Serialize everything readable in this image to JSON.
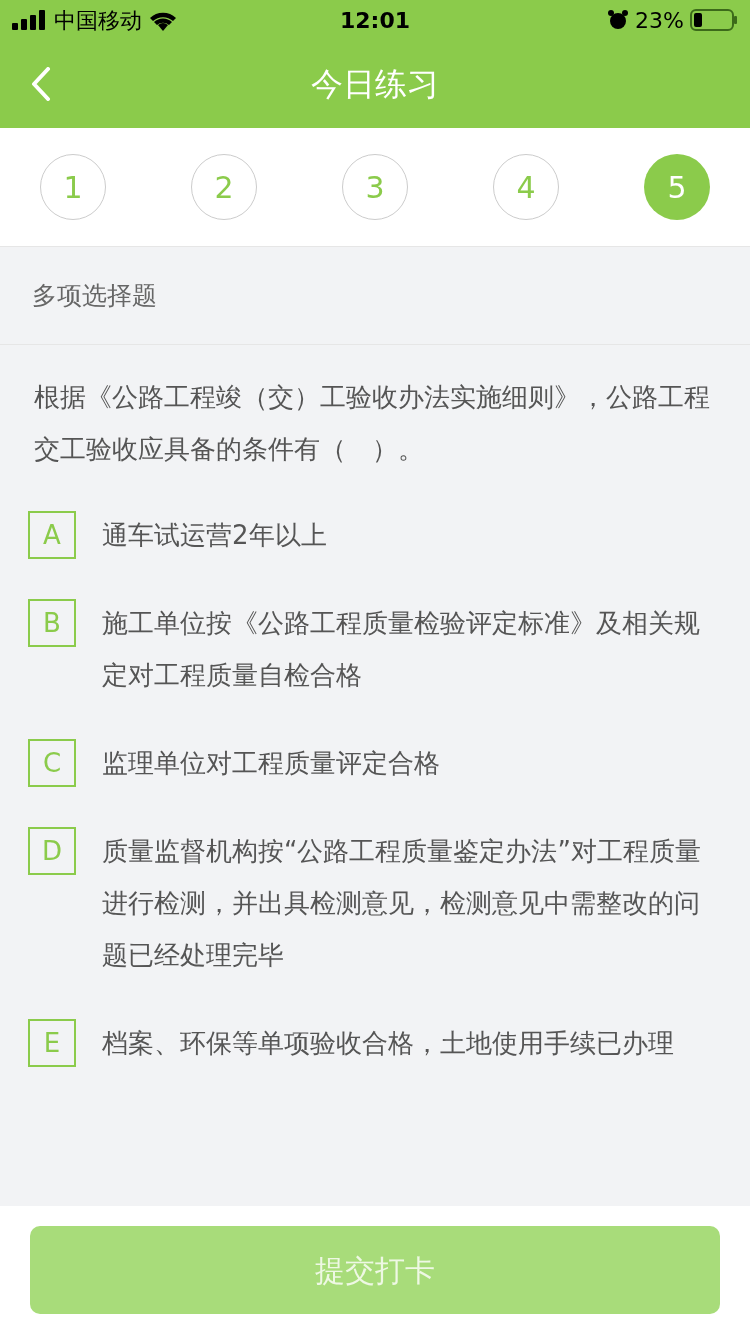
{
  "status_bar": {
    "carrier": "中国移动",
    "time": "12:01",
    "battery": "23%"
  },
  "header": {
    "title": "今日练习"
  },
  "steps": [
    {
      "label": "1",
      "selected": false
    },
    {
      "label": "2",
      "selected": false
    },
    {
      "label": "3",
      "selected": false
    },
    {
      "label": "4",
      "selected": false
    },
    {
      "label": "5",
      "selected": true
    }
  ],
  "question_type": "多项选择题",
  "question": "根据《公路工程竣（交）工验收办法实施细则》，公路工程交工验收应具备的条件有（　）。",
  "options": [
    {
      "letter": "A",
      "text": "通车试运营2年以上",
      "selected": false
    },
    {
      "letter": "B",
      "text": "施工单位按《公路工程质量检验评定标准》及相关规定对工程质量自检合格",
      "selected": false
    },
    {
      "letter": "C",
      "text": "监理单位对工程质量评定合格",
      "selected": false
    },
    {
      "letter": "D",
      "text": "质量监督机构按“公路工程质量鉴定办法”对工程质量进行检测，并出具检测意见，检测意见中需整改的问题已经处理完毕",
      "selected": false
    },
    {
      "letter": "E",
      "text": "档案、环保等单项验收合格，土地使用手续已办理",
      "selected": false
    }
  ],
  "submit": {
    "label": "提交打卡",
    "disabled": true
  }
}
